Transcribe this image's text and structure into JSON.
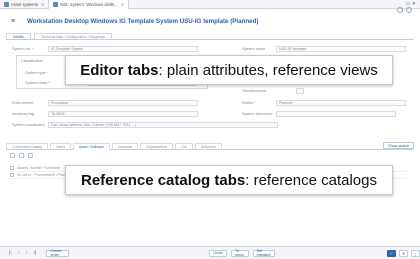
{
  "window": {
    "tabs": [
      {
        "label": "Asset systems"
      },
      {
        "label": "Edit: System: Windows deskt..."
      }
    ]
  },
  "header": {
    "title": "Workstation Desktop Windows IG Template System USU-IG template (Planned)"
  },
  "editor_tabs": [
    {
      "label": "Details"
    },
    {
      "label": "Technical data / Configuration / Mappings"
    }
  ],
  "form": {
    "system_no_label": "System no. *",
    "system_no_value": "IG Template System",
    "system_name_label": "System name",
    "system_name_value": "USU-IG template",
    "classification_label": "Classification",
    "system_type_label": "System type *",
    "system_class_label": "System class *",
    "system_class_value": "Workplace",
    "obsolescence_label": "Obsolescence",
    "environment_label": "Environment",
    "environment_value": "Production",
    "status_label": "Status *",
    "status_value": "Planned",
    "inventory_tag_label": "Inventory tag",
    "inventory_tag_value": "TA-8518",
    "system_document_label": "System document",
    "coordinator_label": "System coordinator",
    "coordinator_value": "Carl Jonas Willems, Mrs. / Lichter (+49 6517 3011 ...)"
  },
  "callouts": {
    "editor_bold": "Editor tabs",
    "editor_rest": ": plain attributes, reference views",
    "catalog_bold": "Reference catalog tabs",
    "catalog_rest": ": reference catalogs"
  },
  "catalog_tabs": [
    {
      "label": "Component Catalog"
    },
    {
      "label": "Users"
    },
    {
      "label": "Asset / Software"
    },
    {
      "label": "Contracts"
    },
    {
      "label": "Organizations"
    },
    {
      "label": "Ord"
    },
    {
      "label": "Deliveries"
    }
  ],
  "show_search_label": "Show search",
  "ref_rows": [
    {
      "label": "Assets / Mobile / Summary"
    },
    {
      "label": "SC-6614 · Procurement / Planned"
    }
  ],
  "bottom": {
    "create_order": "Create order",
    "order": "Order",
    "to_stock": "To stock",
    "set_installed": "Set installed",
    "check_icon": "check-icon",
    "close_icon": "close-icon"
  }
}
